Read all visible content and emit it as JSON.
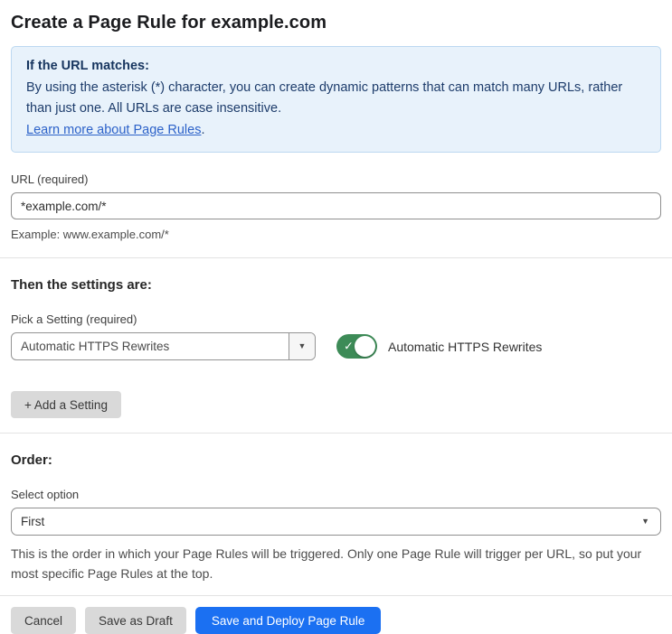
{
  "page": {
    "title": "Create a Page Rule for example.com"
  },
  "info_box": {
    "heading": "If the URL matches:",
    "body": "By using the asterisk (*) character, you can create dynamic patterns that can match many URLs, rather than just one. All URLs are case insensitive.",
    "link_label": "Learn more about Page Rules",
    "link_suffix": "."
  },
  "url_field": {
    "label": "URL (required)",
    "value": "*example.com/*",
    "helper": "Example: www.example.com/*"
  },
  "settings_section": {
    "heading": "Then the settings are:",
    "picker_label": "Pick a Setting (required)",
    "picker_value": "Automatic HTTPS Rewrites",
    "picker_caret_icon": "▼",
    "toggle_state": "on",
    "toggle_check_icon": "✓",
    "toggle_label": "Automatic HTTPS Rewrites",
    "add_button_label": "+ Add a Setting"
  },
  "order_section": {
    "heading": "Order:",
    "select_label": "Select option",
    "select_value": "First",
    "select_caret_icon": "▼",
    "helper": "This is the order in which your Page Rules will be triggered. Only one Page Rule will trigger per URL, so put your most specific Page Rules at the top."
  },
  "footer": {
    "cancel_label": "Cancel",
    "save_draft_label": "Save as Draft",
    "save_deploy_label": "Save and Deploy Page Rule"
  },
  "colors": {
    "info_box_bg": "#e8f2fb",
    "info_box_border": "#bcd8f1",
    "info_text": "#1d3c6b",
    "link_blue": "#2c62c9",
    "toggle_green": "#3d8b57",
    "primary_blue": "#1b70f2",
    "secondary_button_bg": "#d9d9d9",
    "divider": "#e3e3e3"
  }
}
